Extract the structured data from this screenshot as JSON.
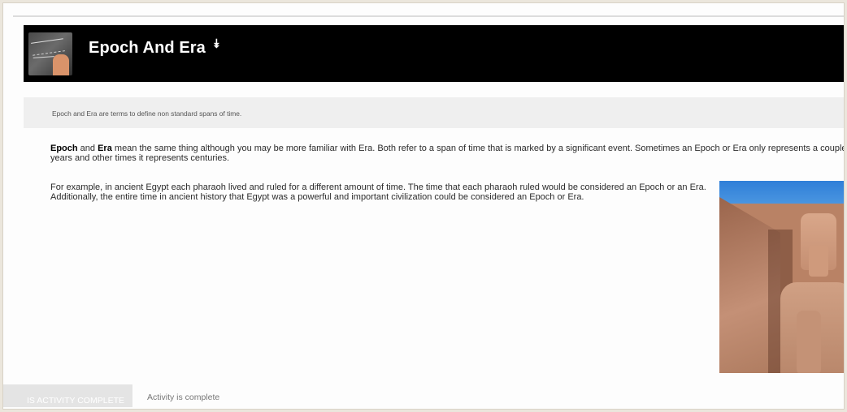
{
  "header": {
    "title": "Epoch And Era",
    "chevron_icon": "double-chevron-down-icon",
    "thumbnail": "chalkboard-thumbnail"
  },
  "summary": {
    "text": "Epoch and Era are terms to define non standard spans of time."
  },
  "body": {
    "para1_bold1": "Epoch",
    "para1_and": " and ",
    "para1_bold2": "Era",
    "para1_rest": " mean the same thing although you may be more familiar with Era. Both refer to a span of time that is marked by a significant event. Sometimes an Epoch or Era only represents a couple of years and other times it represents centuries.",
    "para2": "For example, in ancient Egypt each pharaoh lived and ruled for a different amount of time. The time that each pharaoh ruled would be considered an Epoch or an Era. Additionally, the entire time in ancient history that Egypt was a powerful and important civilization could be considered an Epoch or Era."
  },
  "image": {
    "subject": "pharaoh-statue-photo"
  },
  "footer": {
    "button_label": "IS ACTIVITY COMPLETE",
    "status_text": "Activity is complete"
  }
}
